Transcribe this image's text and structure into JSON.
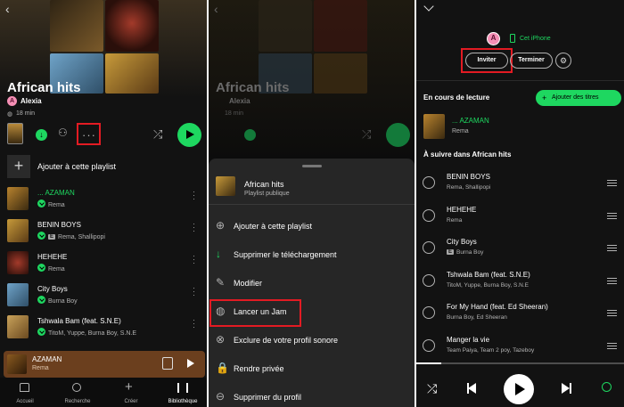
{
  "colors": {
    "accent": "#1ed760",
    "highlight": "#e31b23",
    "bg": "#121212"
  },
  "library": {
    "playlist_title": "African hits",
    "owner": "Alexia",
    "owner_initial": "A",
    "duration": "18 min",
    "add_to_playlist": "Ajouter à cette playlist",
    "tracks": [
      {
        "title": "... AZAMAN",
        "artist": "Rema",
        "explicit": false,
        "playing": true
      },
      {
        "title": "BENIN BOYS",
        "artist": "Rema, Shallipopi",
        "explicit": true,
        "playing": false
      },
      {
        "title": "HEHEHE",
        "artist": "Rema",
        "explicit": false,
        "playing": false
      },
      {
        "title": "City Boys",
        "artist": "Burna Boy",
        "explicit": false,
        "playing": false
      },
      {
        "title": "Tshwala Bam (feat. S.N.E)",
        "artist": "TitoM, Yuppe, Burna Boy, S.N.E",
        "explicit": false,
        "playing": false
      }
    ],
    "now_playing": {
      "title": "AZAMAN",
      "artist": "Rema"
    },
    "nav": [
      {
        "label": "Accueil",
        "icon": "home-icon"
      },
      {
        "label": "Recherche",
        "icon": "search-icon"
      },
      {
        "label": "Créer",
        "icon": "plus-icon"
      },
      {
        "label": "Bibliothèque",
        "icon": "library-icon"
      }
    ]
  },
  "sheet": {
    "bg_title": "African hits",
    "bg_owner": "Alexia",
    "bg_duration": "18 min",
    "title": "African hits",
    "subtitle": "Playlist publique",
    "items": [
      {
        "label": "Ajouter à cette playlist",
        "icon": "add-circle-icon"
      },
      {
        "label": "Supprimer le téléchargement",
        "icon": "download-done-icon"
      },
      {
        "label": "Modifier",
        "icon": "pencil-icon"
      },
      {
        "label": "Lancer un Jam",
        "icon": "jam-icon"
      },
      {
        "label": "Exclure de votre profil sonore",
        "icon": "exclude-icon"
      },
      {
        "label": "Rendre privée",
        "icon": "lock-icon"
      },
      {
        "label": "Supprimer du profil",
        "icon": "profile-remove-icon"
      }
    ]
  },
  "queue": {
    "device_initial": "A",
    "device_name": "Cet iPhone",
    "invite_label": "Inviter",
    "end_label": "Terminer",
    "now_playing_header": "En cours de lecture",
    "add_tracks_label": "Ajouter des titres",
    "current": {
      "title": "... AZAMAN",
      "artist": "Rema"
    },
    "up_next_header": "À suivre dans African hits",
    "tracks": [
      {
        "title": "BENIN BOYS",
        "artist": "Rema, Shallipopi",
        "explicit": false
      },
      {
        "title": "HEHEHE",
        "artist": "Rema",
        "explicit": false
      },
      {
        "title": "City Boys",
        "artist": "Burna Boy",
        "explicit": true
      },
      {
        "title": "Tshwala Bam (feat. S.N.E)",
        "artist": "TitoM, Yuppe, Burna Boy, S.N.E",
        "explicit": false
      },
      {
        "title": "For My Hand (feat. Ed Sheeran)",
        "artist": "Burna Boy, Ed Sheeran",
        "explicit": false
      },
      {
        "title": "Manger la vie",
        "artist": "Team Paiya, Team 2 poy, Tazeboy",
        "explicit": false
      }
    ]
  }
}
